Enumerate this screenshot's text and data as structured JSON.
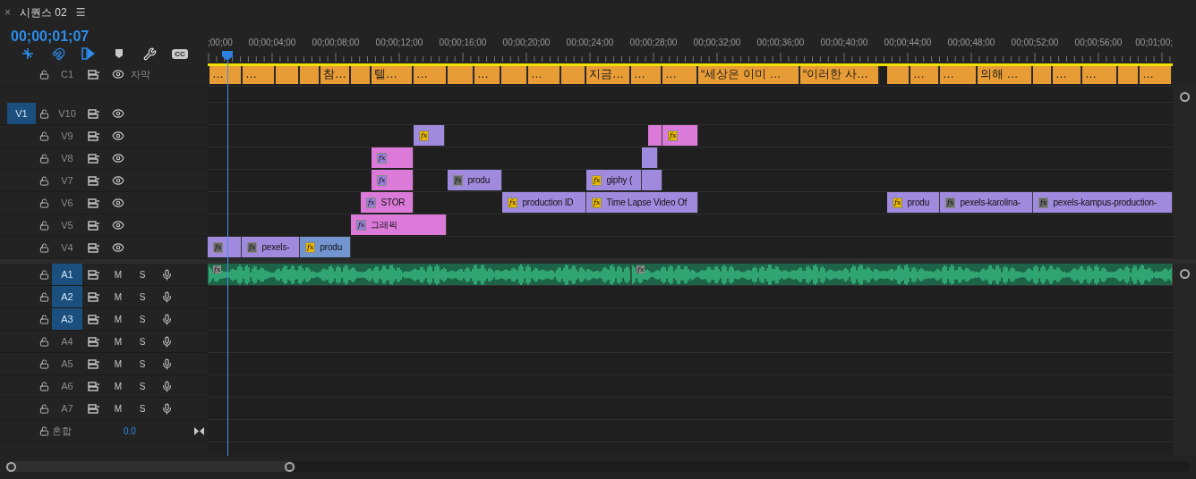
{
  "panel": {
    "close": "×",
    "title": "시퀀스 02",
    "menu": "☰"
  },
  "timecode": "00;00;01;07",
  "tools": [
    {
      "kind": "nest",
      "on": true
    },
    {
      "kind": "snap",
      "on": true
    },
    {
      "kind": "linked",
      "on": true
    },
    {
      "kind": "marker",
      "on": false
    },
    {
      "kind": "settings",
      "on": false
    },
    {
      "kind": "captions",
      "label": "CC",
      "on": false
    }
  ],
  "ruler": [
    ";00;00",
    "00;00;04;00",
    "00;00;08;00",
    "00;00;12;00",
    "00;00;16;00",
    "00;00;20;00",
    "00;00;24;00",
    "00;00;28;00",
    "00;00;32;00",
    "00;00;36;00",
    "00;00;40;00",
    "00;00;44;00",
    "00;00;48;00",
    "00;00;52;00",
    "00;00;56;00",
    "00;01;00;"
  ],
  "caption_track": {
    "name": "C1",
    "label": "자막",
    "clips": [
      {
        "kind": "text",
        "text": "…"
      },
      {
        "kind": "text",
        "text": "…"
      },
      {
        "kind": "blank"
      },
      {
        "kind": "blank"
      },
      {
        "kind": "text",
        "text": "참…"
      },
      {
        "kind": "blank"
      },
      {
        "kind": "text",
        "text": "텔…"
      },
      {
        "kind": "text",
        "text": "…"
      },
      {
        "kind": "blank"
      },
      {
        "kind": "text",
        "text": "…"
      },
      {
        "kind": "blank"
      },
      {
        "kind": "text",
        "text": "…"
      },
      {
        "kind": "blank"
      },
      {
        "kind": "text",
        "text": "지금…"
      },
      {
        "kind": "text",
        "text": "…"
      },
      {
        "kind": "text",
        "text": "…"
      },
      {
        "kind": "text",
        "text": "“세상은 이미 …"
      },
      {
        "kind": "text",
        "text": "“이러한 사…"
      },
      {
        "kind": "blank"
      },
      {
        "kind": "text",
        "text": "…"
      },
      {
        "kind": "text",
        "text": "…"
      },
      {
        "kind": "text",
        "text": "의해 …"
      },
      {
        "kind": "blank"
      },
      {
        "kind": "text",
        "text": "…"
      },
      {
        "kind": "text",
        "text": "…"
      },
      {
        "kind": "blank"
      },
      {
        "kind": "text",
        "text": "…"
      }
    ]
  },
  "video_tracks": [
    {
      "name": "V10",
      "source": "V1"
    },
    {
      "name": "V9",
      "clips": [
        {
          "color": "#a08ade",
          "fx": {
            "label": "fx",
            "color": "#e8b800"
          }
        },
        {
          "color": "#dc7ada"
        },
        {
          "color": "#dc7ada",
          "fx": {
            "label": "fx",
            "color": "#e8b800"
          }
        }
      ]
    },
    {
      "name": "V8",
      "clips": [
        {
          "color": "#dc7ada",
          "fx": {
            "label": "fx",
            "color": "#9a7fd8"
          }
        },
        {
          "color": "#a08ade"
        }
      ]
    },
    {
      "name": "V7",
      "clips": [
        {
          "color": "#dc7ada",
          "fx": {
            "label": "fx",
            "color": "#9a7fd8"
          }
        },
        {
          "color": "#a08ade",
          "fx": {
            "label": "fx",
            "color": "#6a6a6a"
          },
          "text": "produ"
        },
        {
          "color": "#a08ade",
          "fx": {
            "label": "fx",
            "color": "#e8b800"
          },
          "text": "giphy ("
        },
        {
          "color": "#a08ade"
        }
      ]
    },
    {
      "name": "V6",
      "clips": [
        {
          "color": "#dc7ada",
          "fx": {
            "label": "fx",
            "color": "#9a7fd8"
          },
          "text": "STOR"
        },
        {
          "color": "#a08ade",
          "fx": {
            "label": "fx",
            "color": "#e8b800"
          },
          "text": "production ID"
        },
        {
          "color": "#a08ade",
          "fx": {
            "label": "fx",
            "color": "#e8b800"
          },
          "text": "Time Lapse Video Of"
        },
        {
          "color": "#a08ade",
          "fx": {
            "label": "fx",
            "color": "#e8b800"
          },
          "text": "produ"
        },
        {
          "color": "#a08ade",
          "fx": {
            "label": "fx",
            "color": "#6a6a6a"
          },
          "text": "pexels-karolina-"
        },
        {
          "color": "#a08ade",
          "fx": {
            "label": "fx",
            "color": "#6a6a6a"
          },
          "text": "pexels-kampus-production-"
        }
      ]
    },
    {
      "name": "V5",
      "clips": [
        {
          "color": "#dc7ada",
          "fx": {
            "label": "fx",
            "color": "#9a7fd8"
          },
          "text": "그래픽"
        }
      ]
    },
    {
      "name": "V4",
      "clips": [
        {
          "color": "#a08ade",
          "fx": {
            "label": "fx",
            "color": "#6a6a6a"
          }
        },
        {
          "color": "#a08ade",
          "fx": {
            "label": "fx",
            "color": "#6a6a6a"
          },
          "text": "pexels-"
        },
        {
          "color": "#7395cf",
          "fx": {
            "label": "fx",
            "color": "#e8b800"
          },
          "text": "produ"
        }
      ]
    }
  ],
  "audio_tracks": [
    {
      "name": "A1",
      "targeted": true,
      "mute": "M",
      "solo": "S",
      "clips": [
        {
          "fx": "fx"
        },
        {
          "fx": "fx"
        }
      ]
    },
    {
      "name": "A2",
      "targeted": true,
      "mute": "M",
      "solo": "S"
    },
    {
      "name": "A3",
      "targeted": true,
      "mute": "M",
      "solo": "S"
    },
    {
      "name": "A4",
      "targeted": false,
      "mute": "M",
      "solo": "S"
    },
    {
      "name": "A5",
      "targeted": false,
      "mute": "M",
      "solo": "S"
    },
    {
      "name": "A6",
      "targeted": false,
      "mute": "M",
      "solo": "S"
    },
    {
      "name": "A7",
      "targeted": false,
      "mute": "M",
      "solo": "S"
    }
  ],
  "mix": {
    "label": "혼합",
    "value": "0.0"
  }
}
